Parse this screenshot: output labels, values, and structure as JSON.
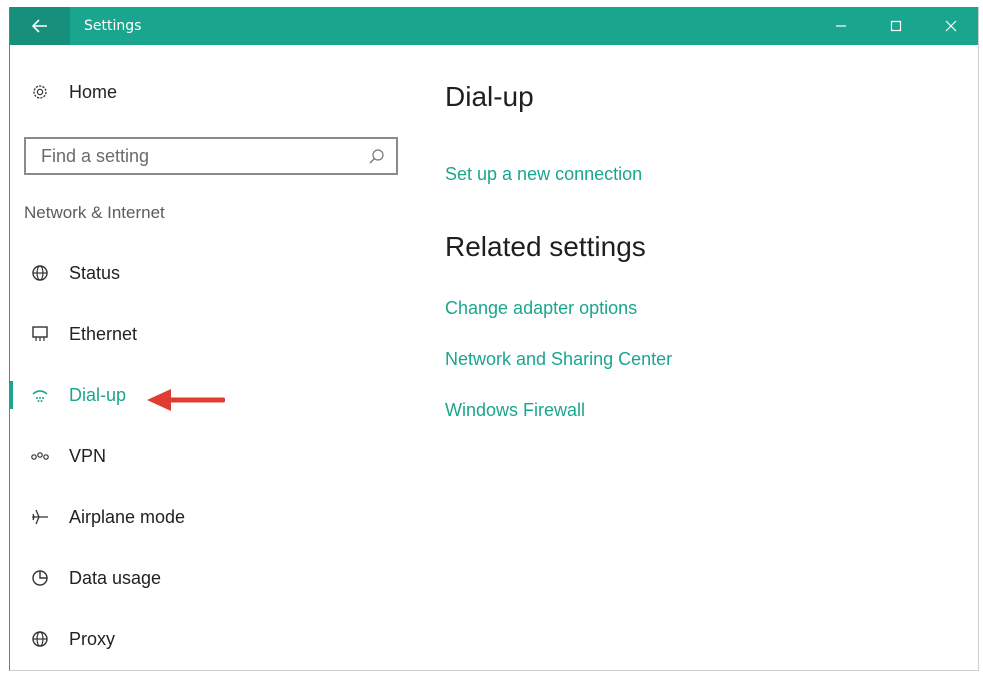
{
  "window": {
    "title": "Settings"
  },
  "sidebar": {
    "home_label": "Home",
    "search_placeholder": "Find a setting",
    "section_label": "Network & Internet",
    "items": [
      {
        "label": "Status",
        "icon": "status-globe-icon"
      },
      {
        "label": "Ethernet",
        "icon": "ethernet-icon"
      },
      {
        "label": "Dial-up",
        "icon": "dial-up-icon",
        "selected": true
      },
      {
        "label": "VPN",
        "icon": "vpn-icon"
      },
      {
        "label": "Airplane mode",
        "icon": "airplane-icon"
      },
      {
        "label": "Data usage",
        "icon": "data-usage-icon"
      },
      {
        "label": "Proxy",
        "icon": "proxy-globe-icon"
      }
    ]
  },
  "main": {
    "title": "Dial-up",
    "setup_link": "Set up a new connection",
    "related_title": "Related settings",
    "related_links": [
      "Change adapter options",
      "Network and Sharing Center",
      "Windows Firewall"
    ]
  },
  "colors": {
    "accent": "#1aa68e",
    "arrow": "#e03c31"
  }
}
